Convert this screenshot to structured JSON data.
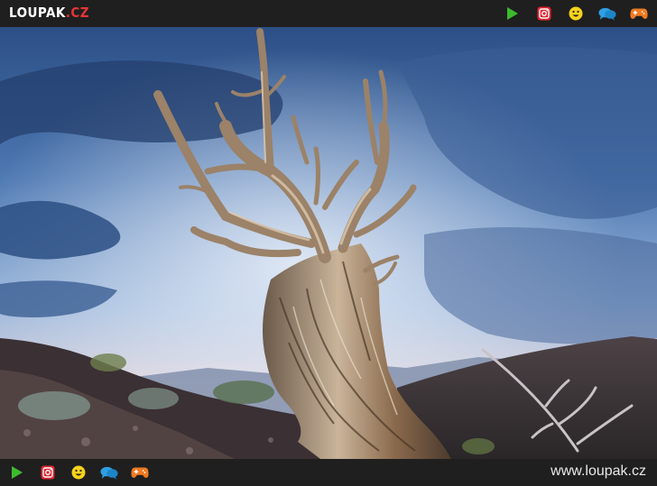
{
  "header": {
    "logo_main": "LOUPAK",
    "logo_suffix": ".CZ",
    "icons": [
      "play-icon",
      "instagram-icon",
      "smiley-icon",
      "chat-icon",
      "gamepad-icon"
    ]
  },
  "footer": {
    "site_url": "www.loupak.cz",
    "icons": [
      "play-icon",
      "instagram-icon",
      "smiley-icon",
      "chat-icon",
      "gamepad-icon"
    ]
  },
  "colors": {
    "bar_bg": "#1f1f1f",
    "play": "#3dbb2e",
    "instagram": "#e0242f",
    "smiley": "#f6d21a",
    "chat": "#2f9fe3",
    "gamepad": "#f07a22",
    "logo_accent": "#e53535"
  },
  "image": {
    "subject": "ancient bristlecone pine",
    "sky": "blue-cloudy"
  }
}
